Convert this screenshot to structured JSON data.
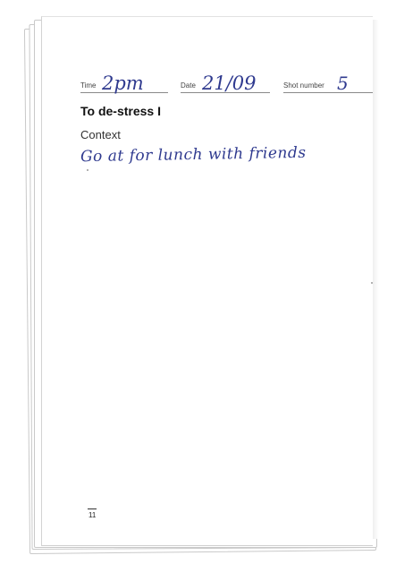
{
  "form": {
    "time": {
      "label": "Time",
      "value": "2pm"
    },
    "date": {
      "label": "Date",
      "value": "21/09"
    },
    "shot": {
      "label": "Shot number",
      "value": "5"
    }
  },
  "heading": "To de-stress I",
  "context": {
    "label": "Context",
    "handwritten": "Go at for lunch with friends"
  },
  "page_number": "11",
  "colors": {
    "ink": "#2f3a8f",
    "paper": "#ffffff"
  }
}
